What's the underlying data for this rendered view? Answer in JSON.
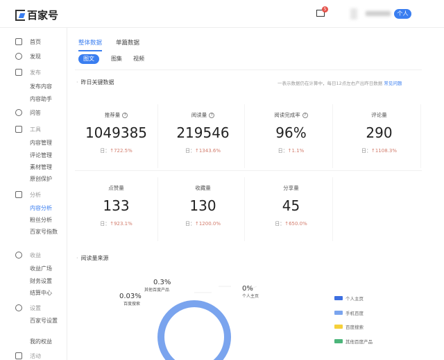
{
  "header": {
    "logo": "百家号",
    "mail_badge": "5",
    "account_type": "个人"
  },
  "sidebar": {
    "items": [
      {
        "label": "首页",
        "type": "group",
        "icon": "home-icon"
      },
      {
        "label": "发现",
        "type": "group",
        "icon": "eye-icon"
      },
      {
        "label": "发布",
        "type": "group",
        "icon": "edit-icon"
      },
      {
        "label": "发布内容",
        "type": "sub"
      },
      {
        "label": "内容助手",
        "type": "sub"
      },
      {
        "label": "问答",
        "type": "group",
        "icon": "question-icon"
      },
      {
        "label": "工具",
        "type": "group",
        "icon": "toolbox-icon"
      },
      {
        "label": "内容管理",
        "type": "sub"
      },
      {
        "label": "评论管理",
        "type": "sub"
      },
      {
        "label": "素材管理",
        "type": "sub"
      },
      {
        "label": "原创保护",
        "type": "sub"
      },
      {
        "label": "分析",
        "type": "group",
        "icon": "chart-icon"
      },
      {
        "label": "内容分析",
        "type": "sub",
        "active": true
      },
      {
        "label": "粉丝分析",
        "type": "sub"
      },
      {
        "label": "百家号指数",
        "type": "sub"
      },
      {
        "label": "收益",
        "type": "group",
        "icon": "coin-icon"
      },
      {
        "label": "收益广场",
        "type": "sub"
      },
      {
        "label": "财务设置",
        "type": "sub"
      },
      {
        "label": "结算中心",
        "type": "sub"
      },
      {
        "label": "设置",
        "type": "group",
        "icon": "gear-icon"
      },
      {
        "label": "百家号设置",
        "type": "sub"
      },
      {
        "label": "我的权益",
        "type": "sub"
      },
      {
        "label": "活动",
        "type": "group",
        "icon": "gift-icon"
      }
    ]
  },
  "tabs": [
    "整体数据",
    "单篇数据"
  ],
  "subtabs": [
    "图文",
    "图集",
    "视频"
  ],
  "section1": {
    "title": "昨日关键数据",
    "note": "一表示数据仍在计算中，每日12点左右产出昨日数据",
    "help": "常见问题"
  },
  "metrics": [
    {
      "label": "推荐量",
      "value": "1049385",
      "change": "↑722.5%",
      "help": true
    },
    {
      "label": "阅读量",
      "value": "219546",
      "change": "↑1343.6%",
      "help": true
    },
    {
      "label": "阅读完成率",
      "value": "96%",
      "change": "↑1.1%",
      "help": true
    },
    {
      "label": "评论量",
      "value": "290",
      "change": "↑1108.3%"
    },
    {
      "label": "点赞量",
      "value": "133",
      "change": "↑923.1%"
    },
    {
      "label": "收藏量",
      "value": "130",
      "change": "↑1200.0%"
    },
    {
      "label": "分享量",
      "value": "45",
      "change": "↑650.0%"
    }
  ],
  "day_prefix": "日：",
  "section2": {
    "title": "阅读量来源"
  },
  "chart_data": {
    "type": "pie",
    "title": "阅读量来源",
    "series": [
      {
        "name": "个人主页",
        "value": 0,
        "label": "0%",
        "color": "#3d6fe0"
      },
      {
        "name": "手机百度",
        "value": 99.67,
        "label": "",
        "color": "#7aa4ee"
      },
      {
        "name": "百度搜索",
        "value": 0.03,
        "label": "0.03%",
        "color": "#f5d03a"
      },
      {
        "name": "其他百度产品",
        "value": 0.3,
        "label": "0.3%",
        "color": "#4cb57a"
      }
    ],
    "legend": "right"
  }
}
